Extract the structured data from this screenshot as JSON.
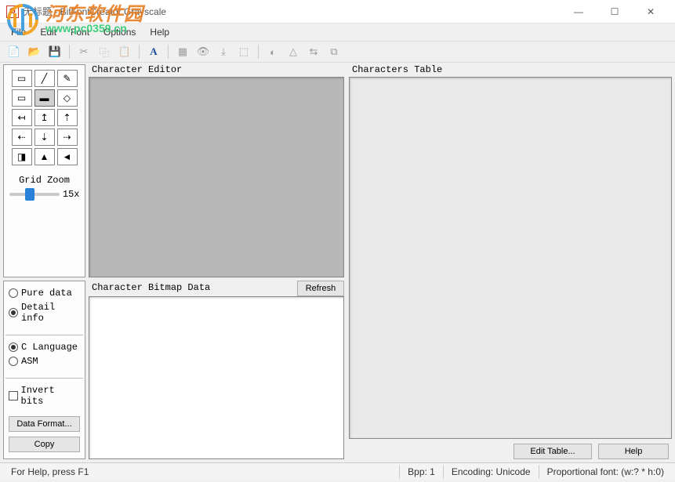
{
  "window": {
    "icon_letter": "G",
    "title": "无标题 - BitFontCreator Grayscale",
    "min_icon": "—",
    "max_icon": "☐",
    "close_icon": "✕"
  },
  "menubar": [
    "File",
    "Edit",
    "Font",
    "Options",
    "Help"
  ],
  "toolbar": {
    "new_icon": "📄",
    "open_icon": "📂",
    "save_icon": "💾",
    "cut_icon": "✂",
    "copy_icon": "⿻",
    "paste_icon": "📋",
    "font_icon": "A",
    "grid_icon": "▦",
    "preview_icon": "👁",
    "export_icon": "⤓",
    "data_icon": "⬚",
    "invert_icon": "◐",
    "mirror_icon": "△",
    "shift_icon": "⇆",
    "map_icon": "⧉"
  },
  "tools": {
    "grid_zoom_label": "Grid Zoom",
    "zoom_value": "15x",
    "items": [
      {
        "name": "select-icon",
        "glyph": "▭"
      },
      {
        "name": "line-icon",
        "glyph": "╱"
      },
      {
        "name": "pencil-icon",
        "glyph": "✎"
      },
      {
        "name": "rect-icon",
        "glyph": "▭"
      },
      {
        "name": "fillrect-icon",
        "glyph": "▬"
      },
      {
        "name": "eraser-icon",
        "glyph": "◇"
      },
      {
        "name": "shift-left-icon",
        "glyph": "↤"
      },
      {
        "name": "shift-up-icon",
        "glyph": "↥"
      },
      {
        "name": "shift-up2-icon",
        "glyph": "⇡"
      },
      {
        "name": "shift-left2-icon",
        "glyph": "⇠"
      },
      {
        "name": "shift-down-icon",
        "glyph": "⇣"
      },
      {
        "name": "shift-right-icon",
        "glyph": "⇢"
      },
      {
        "name": "invert-icon",
        "glyph": "◨"
      },
      {
        "name": "flip-v-icon",
        "glyph": "▲"
      },
      {
        "name": "flip-h-icon",
        "glyph": "◄"
      }
    ]
  },
  "panels": {
    "char_editor_title": "Character Editor",
    "char_data_title": "Character Bitmap Data",
    "refresh_label": "Refresh",
    "chars_table_title": "Characters Table"
  },
  "options": {
    "pure_data": "Pure data",
    "detail_info": "Detail info",
    "c_lang": "C Language",
    "asm": "ASM",
    "invert_bits": "Invert bits",
    "data_format_btn": "Data Format...",
    "copy_btn": "Copy"
  },
  "right_buttons": {
    "edit_table": "Edit Table...",
    "help": "Help"
  },
  "statusbar": {
    "help": "For Help, press F1",
    "bpp": "Bpp: 1",
    "encoding": "Encoding: Unicode",
    "font": "Proportional font: (w:? * h:0)"
  },
  "watermark": {
    "cn": "河东软件园",
    "url": "www.pc0359.cn"
  }
}
